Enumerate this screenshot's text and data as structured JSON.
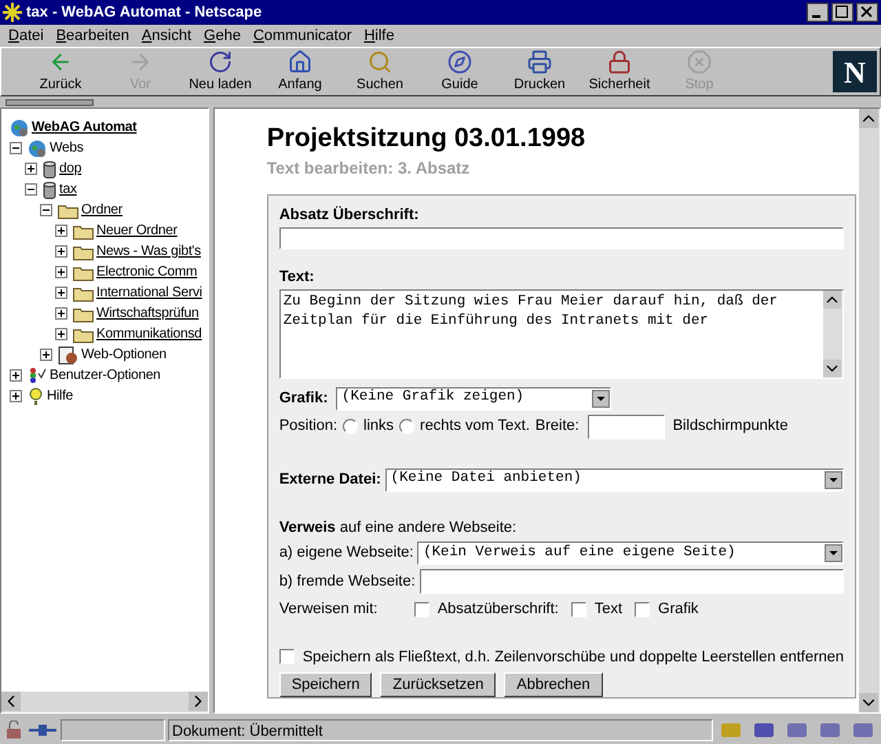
{
  "window": {
    "title": "tax - WebAG Automat - Netscape"
  },
  "menu": [
    {
      "label": "Datei"
    },
    {
      "label": "Bearbeiten"
    },
    {
      "label": "Ansicht"
    },
    {
      "label": "Gehe"
    },
    {
      "label": "Communicator"
    },
    {
      "label": "Hilfe"
    }
  ],
  "toolbar": [
    {
      "label": "Zurück",
      "kind": "back",
      "disabled": false
    },
    {
      "label": "Vor",
      "kind": "forward",
      "disabled": true
    },
    {
      "label": "Neu laden",
      "kind": "reload",
      "disabled": false
    },
    {
      "label": "Anfang",
      "kind": "home",
      "disabled": false
    },
    {
      "label": "Suchen",
      "kind": "search",
      "disabled": false
    },
    {
      "label": "Guide",
      "kind": "guide",
      "disabled": false
    },
    {
      "label": "Drucken",
      "kind": "print",
      "disabled": false
    },
    {
      "label": "Sicherheit",
      "kind": "security",
      "disabled": false
    },
    {
      "label": "Stop",
      "kind": "stop",
      "disabled": true
    }
  ],
  "logo": "N",
  "tree": [
    {
      "label": "WebAG Automat",
      "kind": "site",
      "link": true,
      "children": [
        {
          "label": "Webs",
          "kind": "webs",
          "link": false,
          "expanded": true,
          "children": [
            {
              "label": "dop",
              "kind": "database",
              "link": true,
              "expanded": false
            },
            {
              "label": "tax",
              "kind": "database",
              "link": true,
              "expanded": true,
              "children": [
                {
                  "label": "Ordner",
                  "kind": "folder",
                  "link": true,
                  "expanded": true,
                  "children": [
                    {
                      "label": "Neuer Ordner",
                      "kind": "folder",
                      "link": true,
                      "expanded": false
                    },
                    {
                      "label": "News - Was gibt's",
                      "kind": "folder",
                      "link": true,
                      "expanded": false
                    },
                    {
                      "label": "Electronic Comm",
                      "kind": "folder",
                      "link": true,
                      "expanded": false
                    },
                    {
                      "label": "International Servi",
                      "kind": "folder",
                      "link": true,
                      "expanded": false
                    },
                    {
                      "label": "Wirtschaftsprüfun",
                      "kind": "folder",
                      "link": true,
                      "expanded": false
                    },
                    {
                      "label": "Kommunikationsd",
                      "kind": "folder",
                      "link": true,
                      "expanded": false
                    }
                  ]
                },
                {
                  "label": "Web-Optionen",
                  "kind": "options",
                  "link": false,
                  "expanded": false
                }
              ]
            }
          ]
        },
        {
          "label": "Benutzer-Optionen",
          "kind": "users",
          "link": false,
          "expanded": false
        },
        {
          "label": "Hilfe",
          "kind": "help",
          "link": false,
          "expanded": false
        }
      ]
    }
  ],
  "page": {
    "title": "Projektsitzung 03.01.1998",
    "subtitle": "Text bearbeiten: 3. Absatz"
  },
  "form": {
    "heading_field": {
      "label": "Absatz Überschrift:"
    },
    "text_field": {
      "label": "Text:",
      "lines": [
        "Zu Beginn der Sitzung wies Frau Meier darauf hin, daß der",
        "Zeitplan für die Einführung des Intranets mit der"
      ]
    },
    "grafik": {
      "label": "Grafik:",
      "value": "(Keine Grafik zeigen)"
    },
    "position": {
      "label": "Position:",
      "options": [
        {
          "label": "links",
          "selected": false
        },
        {
          "label": "rechts vom Text.",
          "selected": false
        }
      ],
      "width_label": "Breite:",
      "unit": "Bildschirmpunkte"
    },
    "externe_datei": {
      "label": "Externe Datei:",
      "value": "(Keine Datei anbieten)"
    },
    "verweis": {
      "intro": "**Verweis** auf eine andere Webseite:",
      "own": {
        "label": "a) eigene Webseite:",
        "value": "(Kein Verweis auf eine eigene Seite)"
      },
      "foreign": {
        "label": "b) fremde Webseite:"
      },
      "with_label": "Verweisen mit:",
      "options": [
        {
          "label": "Absatzüberschrift:",
          "checked": false
        },
        {
          "label": "Text",
          "checked": false
        },
        {
          "label": "Grafik",
          "checked": false
        }
      ]
    },
    "plain_text": {
      "label": "Speichern als Fließtext, d.h. Zeilenvorschübe und doppelte Leerstellen entfernen",
      "checked": false
    },
    "buttons": [
      {
        "label": "Speichern"
      },
      {
        "label": "Zurücksetzen"
      },
      {
        "label": "Abbrechen"
      }
    ]
  },
  "status_bar": {
    "text": "Dokument: Übermittelt"
  }
}
